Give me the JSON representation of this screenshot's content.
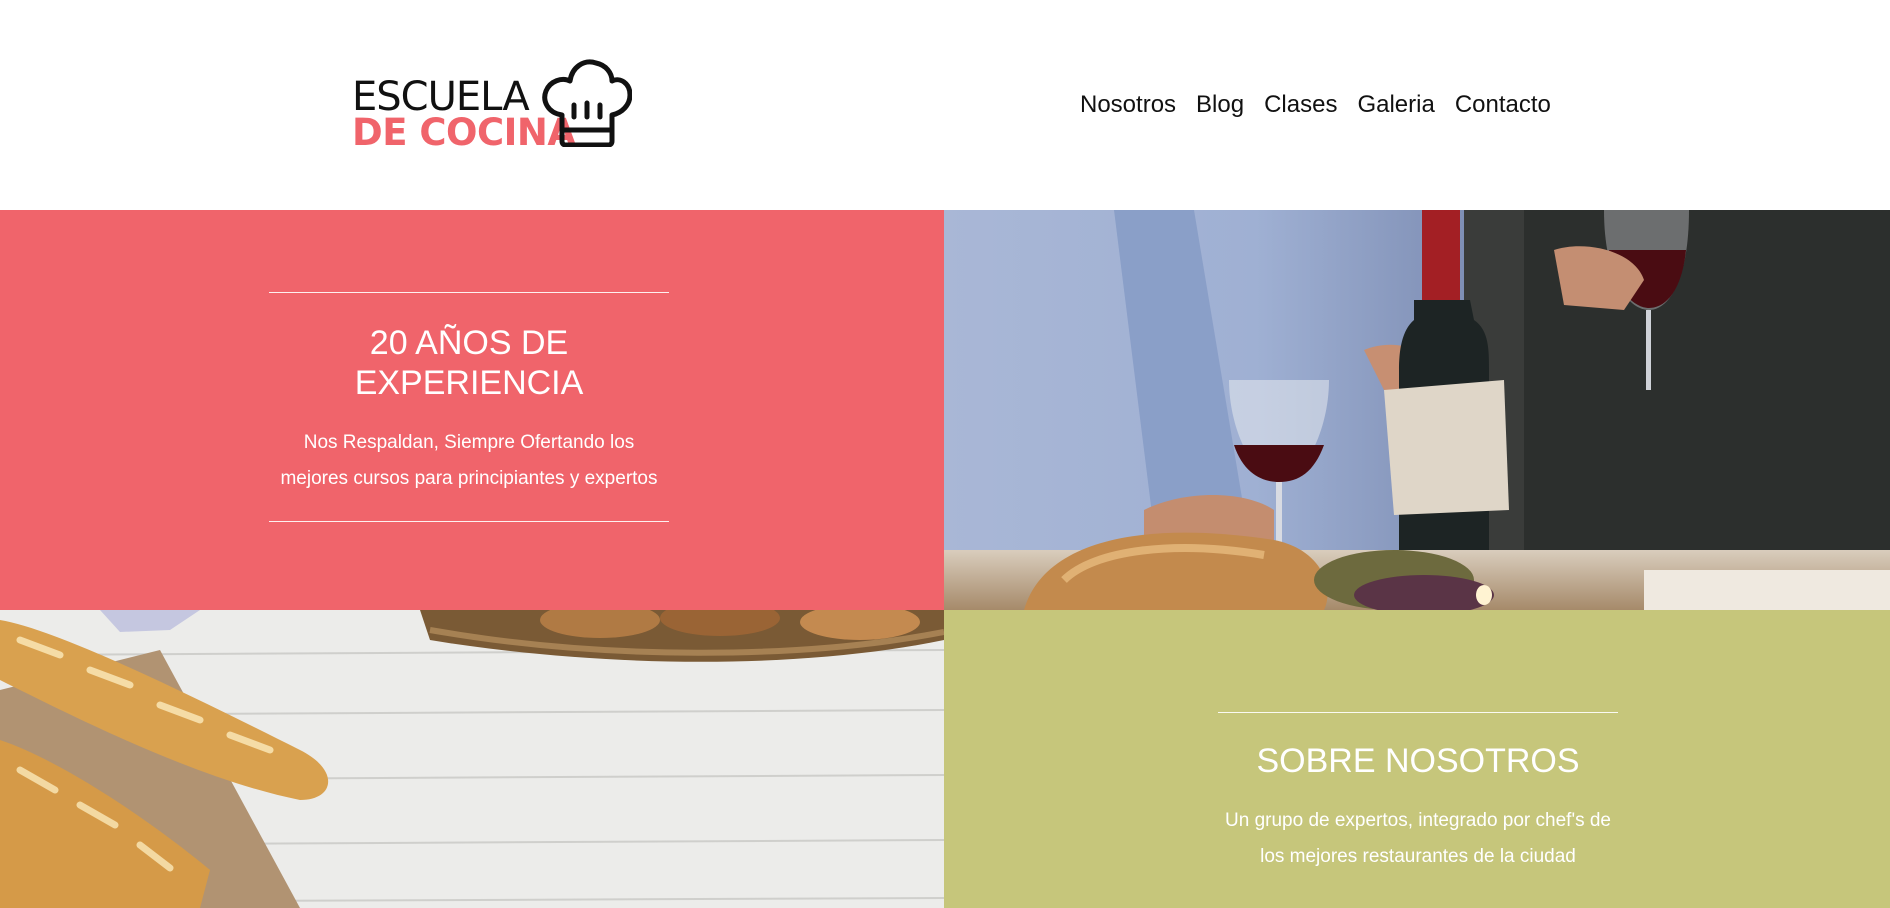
{
  "brand": {
    "line1": "ESCUELA",
    "line2": "DE COCINA",
    "accent_color": "#f0646b"
  },
  "nav": {
    "items": [
      "Nosotros",
      "Blog",
      "Clases",
      "Galeria",
      "Contacto"
    ]
  },
  "experience": {
    "title": "20 AÑOS DE EXPERIENCIA",
    "text": "Nos Respaldan, Siempre Ofertando los mejores cursos para principiantes y expertos",
    "background": "#f0646b"
  },
  "about": {
    "title": "SOBRE NOSOTROS",
    "text": "Un grupo de expertos, integrado por chef's de los mejores restaurantes de la ciudad",
    "background": "#c6c67b"
  },
  "icons": {
    "logo_icon": "chef-hat-icon"
  }
}
